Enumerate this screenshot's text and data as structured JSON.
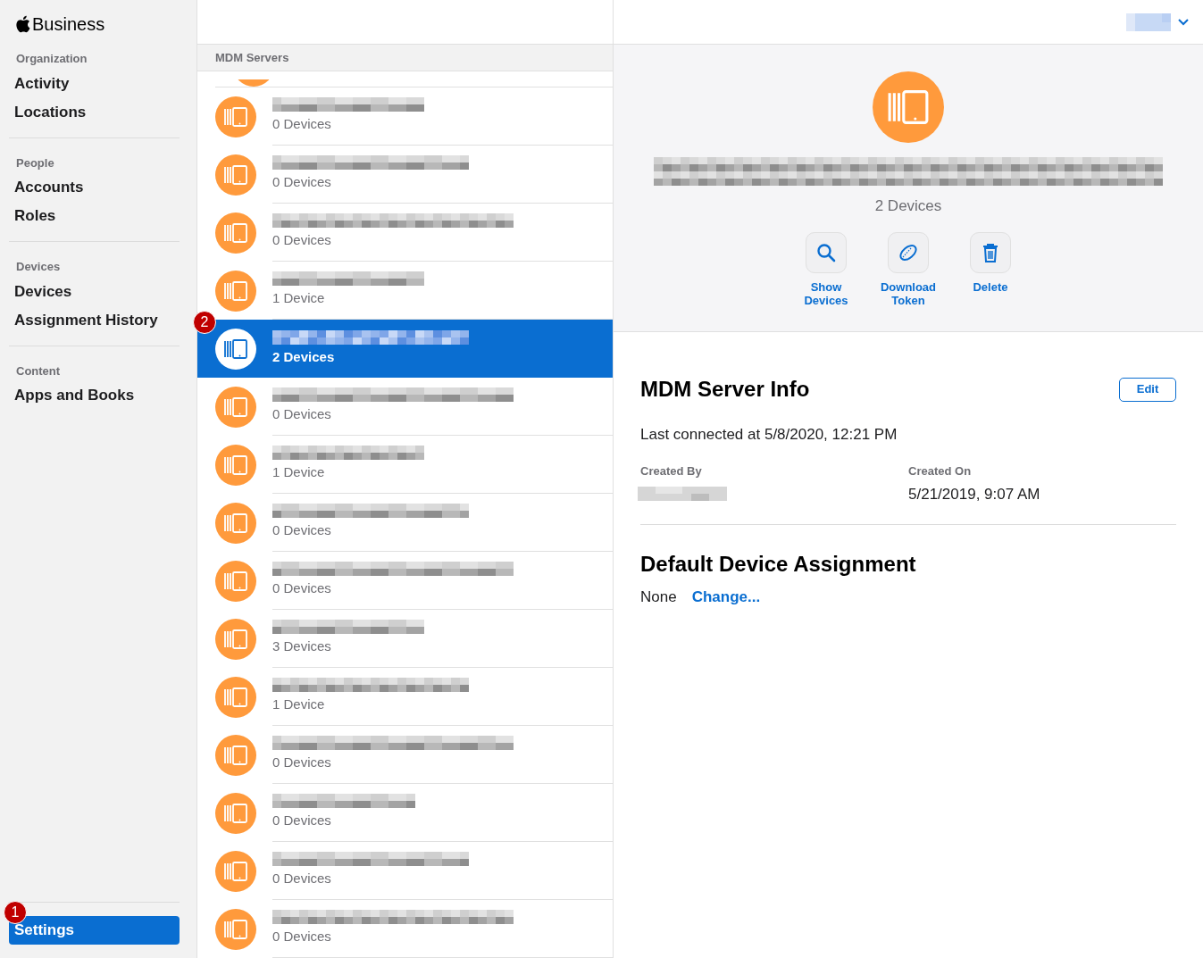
{
  "brand": {
    "name": "Business"
  },
  "sidebar": {
    "sections": [
      {
        "title": "Organization",
        "items": [
          {
            "label": "Activity",
            "selected": false
          },
          {
            "label": "Locations",
            "selected": false
          }
        ]
      },
      {
        "title": "People",
        "items": [
          {
            "label": "Accounts",
            "selected": false
          },
          {
            "label": "Roles",
            "selected": false
          }
        ]
      },
      {
        "title": "Devices",
        "items": [
          {
            "label": "Devices",
            "selected": false
          },
          {
            "label": "Assignment History",
            "selected": false
          }
        ]
      },
      {
        "title": "Content",
        "items": [
          {
            "label": "Apps and Books",
            "selected": false
          }
        ]
      }
    ],
    "footer_item": {
      "label": "Settings",
      "selected": true,
      "marker": "1"
    }
  },
  "server_list": {
    "header": "MDM Servers",
    "rows": [
      {
        "kind": "cut"
      },
      {
        "kind": "server",
        "count": "0 Devices",
        "selected": false
      },
      {
        "kind": "server",
        "count": "0 Devices",
        "selected": false
      },
      {
        "kind": "server",
        "count": "0 Devices",
        "selected": false
      },
      {
        "kind": "server",
        "count": "1 Device",
        "selected": false
      },
      {
        "kind": "server",
        "count": "2 Devices",
        "selected": true,
        "marker": "2"
      },
      {
        "kind": "server",
        "count": "0 Devices",
        "selected": false
      },
      {
        "kind": "server",
        "count": "1 Device",
        "selected": false
      },
      {
        "kind": "server",
        "count": "0 Devices",
        "selected": false
      },
      {
        "kind": "server",
        "count": "0 Devices",
        "selected": false
      },
      {
        "kind": "server",
        "count": "3 Devices",
        "selected": false
      },
      {
        "kind": "server",
        "count": "1 Device",
        "selected": false
      },
      {
        "kind": "server",
        "count": "0 Devices",
        "selected": false
      },
      {
        "kind": "server",
        "count": "0 Devices",
        "selected": false
      },
      {
        "kind": "server",
        "count": "0 Devices",
        "selected": false
      },
      {
        "kind": "server",
        "count": "0 Devices",
        "selected": false
      }
    ]
  },
  "detail": {
    "count": "2 Devices",
    "actions": [
      {
        "kind": "search",
        "label": "Show Devices"
      },
      {
        "kind": "token",
        "label": "Download Token"
      },
      {
        "kind": "delete",
        "label": "Delete"
      }
    ],
    "info_title": "MDM Server Info",
    "edit_button": "Edit",
    "last_connected": "Last connected at 5/8/2020, 12:21 PM",
    "created_by_label": "Created By",
    "created_on_label": "Created On",
    "created_on": "5/21/2019, 9:07 AM",
    "assignment_title": "Default Device Assignment",
    "assignment_value": "None",
    "change_link": "Change..."
  }
}
